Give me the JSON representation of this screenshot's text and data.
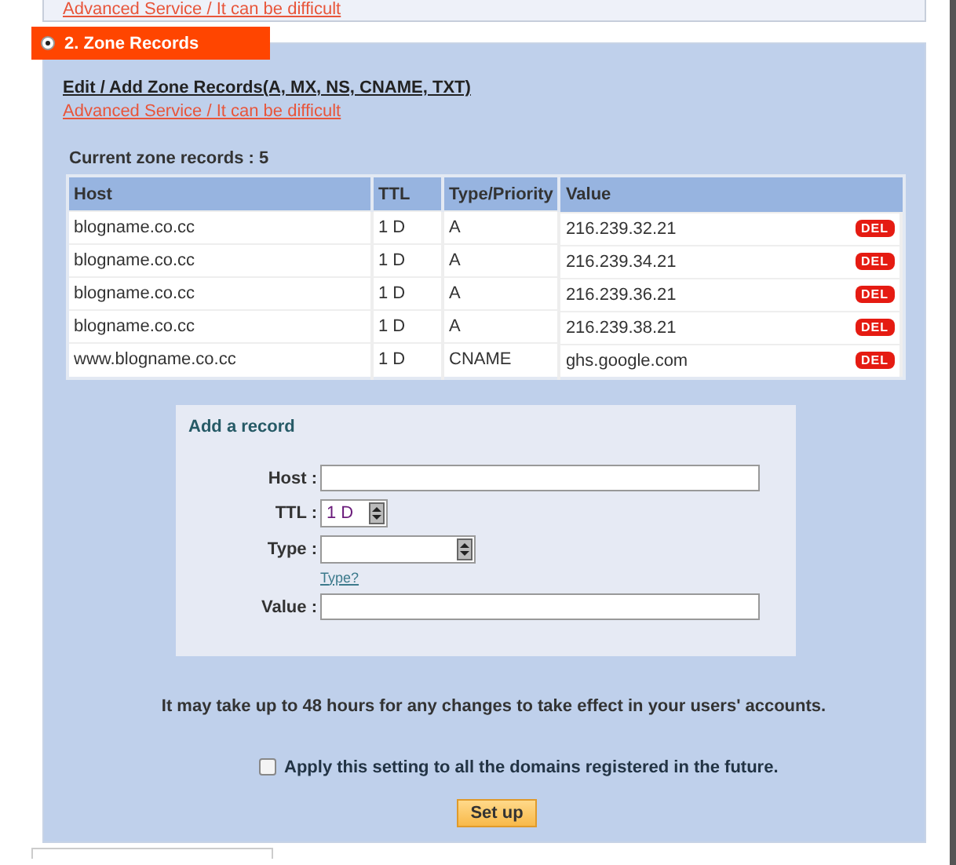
{
  "top_panel": {
    "link": "Advanced Service / It can be difficult"
  },
  "section": {
    "title": "2. Zone Records",
    "expanded": true
  },
  "heading": "Edit / Add Zone Records(A, MX, NS, CNAME, TXT)",
  "advanced_link": "Advanced Service / It can be difficult",
  "records_label": "Current zone records : 5",
  "table": {
    "columns": [
      "Host",
      "TTL",
      "Type/Priority",
      "Value"
    ],
    "rows": [
      {
        "host": "blogname.co.cc",
        "ttl": "1 D",
        "type": "A",
        "value": "216.239.32.21",
        "action": "DEL"
      },
      {
        "host": "blogname.co.cc",
        "ttl": "1 D",
        "type": "A",
        "value": "216.239.34.21",
        "action": "DEL"
      },
      {
        "host": "blogname.co.cc",
        "ttl": "1 D",
        "type": "A",
        "value": "216.239.36.21",
        "action": "DEL"
      },
      {
        "host": "blogname.co.cc",
        "ttl": "1 D",
        "type": "A",
        "value": "216.239.38.21",
        "action": "DEL"
      },
      {
        "host": "www.blogname.co.cc",
        "ttl": "1 D",
        "type": "CNAME",
        "value": "ghs.google.com",
        "action": "DEL"
      }
    ]
  },
  "add_record": {
    "title": "Add a record",
    "fields": [
      {
        "kind": "text",
        "label": "Host :"
      },
      {
        "kind": "select",
        "label": "TTL :",
        "value": "1 D"
      },
      {
        "kind": "select_wide",
        "label": "Type :",
        "help": "Type?"
      },
      {
        "kind": "text",
        "label": "Value :"
      }
    ]
  },
  "notice": "It may take up to 48 hours for any changes to take effect in your users' accounts.",
  "apply_future": {
    "label": "Apply this setting to all the domains registered in the future.",
    "checked": false
  },
  "submit": "Set up"
}
